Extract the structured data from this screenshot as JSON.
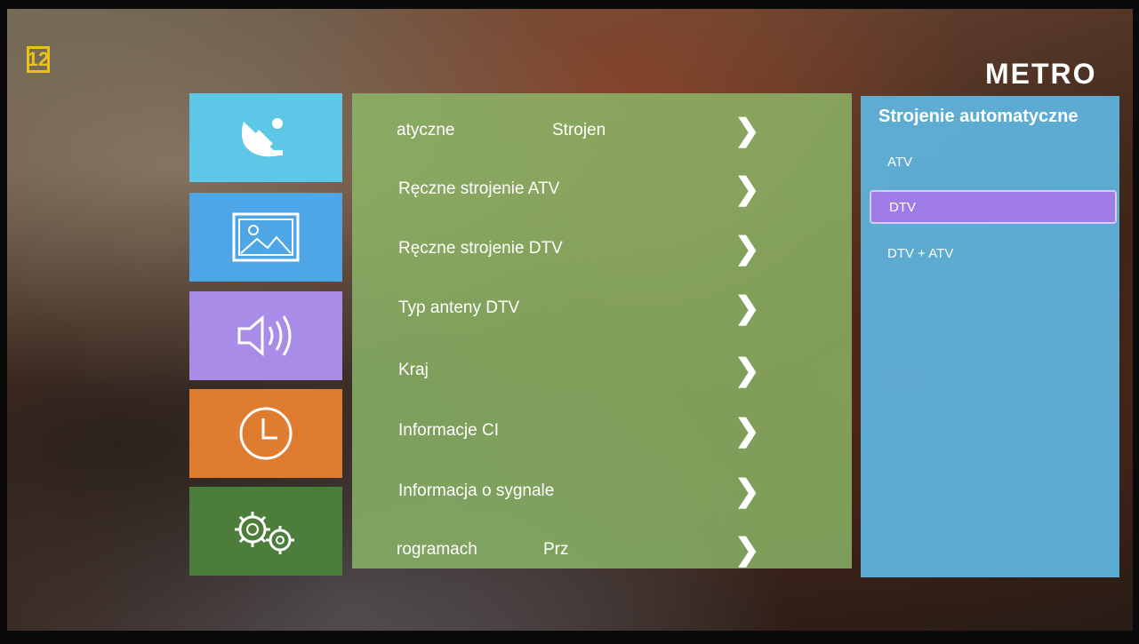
{
  "overlay": {
    "channel_number": "12",
    "brand": "METRO"
  },
  "categories": [
    {
      "name": "tuning",
      "icon": "satellite-dish-icon",
      "color": "#5ec6e6"
    },
    {
      "name": "picture",
      "icon": "picture-icon",
      "color": "#4fa6e6"
    },
    {
      "name": "sound",
      "icon": "speaker-icon",
      "color": "#a98be8"
    },
    {
      "name": "time",
      "icon": "clock-icon",
      "color": "#e07c2f"
    },
    {
      "name": "settings",
      "icon": "gears-icon",
      "color": "#4d7d3a"
    }
  ],
  "menu": {
    "items": [
      {
        "label": "atyczne",
        "value": "Strojen"
      },
      {
        "label": "Ręczne strojenie ATV"
      },
      {
        "label": "Ręczne strojenie DTV"
      },
      {
        "label": "Typ anteny DTV"
      },
      {
        "label": "Kraj"
      },
      {
        "label": "Informacje CI"
      },
      {
        "label": "Informacja o sygnale"
      },
      {
        "label": "rogramach",
        "value": "Prz"
      }
    ],
    "chevron": "❯"
  },
  "submenu": {
    "title": "Strojenie automatyczne",
    "options": [
      {
        "label": "ATV",
        "selected": false
      },
      {
        "label": "DTV",
        "selected": true
      },
      {
        "label": "DTV + ATV",
        "selected": false
      }
    ]
  }
}
